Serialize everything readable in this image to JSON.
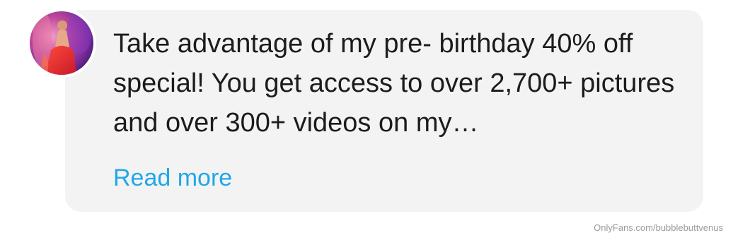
{
  "post": {
    "author_avatar": "profile-photo",
    "message": "Take advantage of my pre- birthday 40% off special! You get access to over 2,700+ pictures and over 300+ videos on my…",
    "read_more_label": "Read more",
    "read_more_color": "#1fa8e8",
    "bubble_color": "#f3f3f3"
  },
  "watermark": {
    "text": "OnlyFans.com/bubblebuttvenus"
  }
}
